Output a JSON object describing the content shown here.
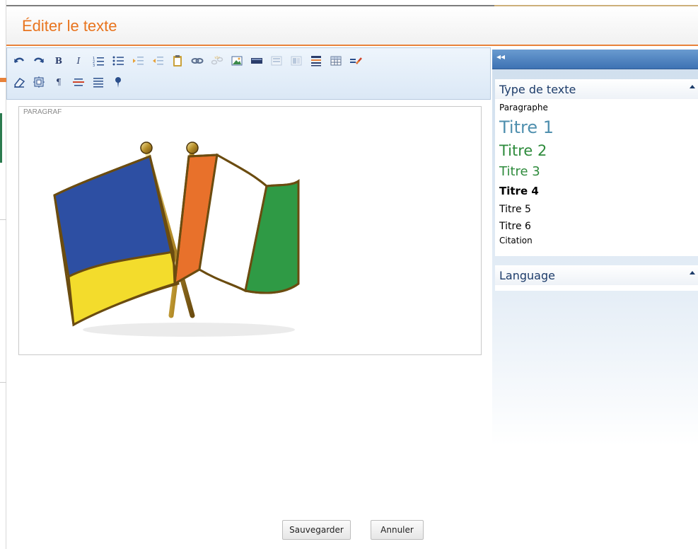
{
  "dialog": {
    "title": "Éditer le texte",
    "accent_color": "#e8741e"
  },
  "toolbar": {
    "row1": [
      {
        "name": "undo-icon"
      },
      {
        "name": "redo-icon"
      },
      {
        "name": "bold-icon",
        "glyph": "B"
      },
      {
        "name": "italic-icon",
        "glyph": "I"
      },
      {
        "name": "ordered-list-icon"
      },
      {
        "name": "unordered-list-icon"
      },
      {
        "name": "indent-icon"
      },
      {
        "name": "outdent-icon"
      },
      {
        "name": "paste-icon"
      },
      {
        "name": "link-icon"
      },
      {
        "name": "unlink-icon"
      },
      {
        "name": "insert-image-icon"
      },
      {
        "name": "insert-media-icon"
      },
      {
        "name": "template-icon"
      },
      {
        "name": "template-alt-icon"
      },
      {
        "name": "layout-icon"
      },
      {
        "name": "insert-table-icon"
      },
      {
        "name": "format-stripper-icon"
      }
    ],
    "row2": [
      {
        "name": "eraser-icon"
      },
      {
        "name": "select-all-icon"
      },
      {
        "name": "paragraph-mark-icon",
        "glyph": "¶"
      },
      {
        "name": "horizontal-rule-icon"
      },
      {
        "name": "align-justify-icon"
      },
      {
        "name": "anchor-pin-icon"
      }
    ]
  },
  "editor": {
    "block_tag": "PARAGRAF",
    "image": "ukraine-ivory-coast-flag-pin",
    "colors": {
      "ukraine_blue": "#2d4fa3",
      "ukraine_yellow": "#f3dc2c",
      "ci_orange": "#e8712b",
      "ci_white": "#ffffff",
      "ci_green": "#2f9a45"
    }
  },
  "panel": {
    "collapse_glyph": "◂◂",
    "text_type": {
      "header": "Type de texte",
      "items": {
        "paragraph": "Paragraphe",
        "h1": "Titre 1",
        "h2": "Titre 2",
        "h3": "Titre 3",
        "h4": "Titre 4",
        "h5": "Titre 5",
        "h6": "Titre 6",
        "quote": "Citation"
      }
    },
    "language": {
      "header": "Language"
    }
  },
  "buttons": {
    "save": "Sauvegarder",
    "cancel": "Annuler"
  }
}
